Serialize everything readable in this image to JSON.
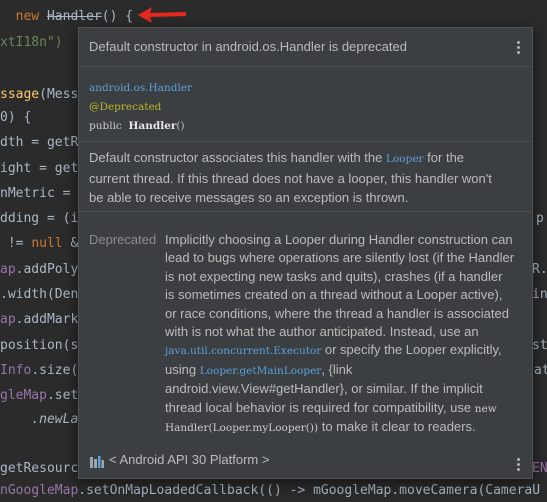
{
  "editor": {
    "line1": {
      "kw": "new",
      "cls": "Handler",
      "rest": "() {"
    },
    "line2": {
      "text": "xtI18n\")"
    },
    "line3": {
      "fn": "ssage",
      "rest": "(Mess"
    },
    "line4": {
      "text": "0) {"
    },
    "line5": {
      "text": "dth = getR"
    },
    "line6": {
      "text": "ight = get"
    },
    "line7": {
      "text": "nMetric ="
    },
    "line8": {
      "text": "dding = (i"
    },
    "line9": {
      "text": "!= ",
      "kw": "null",
      "rest": " &"
    },
    "line10": {
      "fld": "ap",
      "rest": ".addPoly"
    },
    "line11": {
      "text": ".width(Den"
    },
    "line12": {
      "fld": "ap",
      "rest": ".addMark"
    },
    "line13": {
      "text": "position(s"
    },
    "line14": {
      "fld": "Info",
      "rest": ".size("
    },
    "line15": {
      "fld": "gleMap",
      "rest": ".set"
    },
    "line16": {
      "text": ".newLa"
    },
    "line17": {
      "text": "getResourc"
    },
    "line18": {
      "fld": "nGoogleMap",
      "rest": ".setOnMapLoadedCallback(() -> mGoogleMap.moveCamera(CameraU"
    },
    "right_frags": [
      "p",
      "R.",
      "in",
      "st",
      "at",
      "ENG"
    ]
  },
  "popup": {
    "title": "Default constructor in android.os.Handler is deprecated",
    "signature": {
      "package": "android.os.Handler",
      "annotation": "@Deprecated",
      "modifier": "public",
      "method": "Handler",
      "parens": "()"
    },
    "description": {
      "part1": "Default constructor associates this handler with the ",
      "code1": "Looper",
      "part2": " for the current thread. If this thread does not have a looper, this handler won't be able to receive messages so an exception is thrown."
    },
    "deprecated": {
      "label": "Deprecated",
      "part1": "Implicitly choosing a Looper during Handler construction can lead to bugs where operations are silently lost (if the Handler is not expecting new tasks and quits), crashes (if a handler is sometimes created on a thread without a Looper active), or race conditions, where the thread a handler is associated with is not what the author anticipated. Instead, use an ",
      "code1": "java.util.concurrent.Executor",
      "part2": " or specify the Looper explicitly, using ",
      "code2": "Looper.getMainLooper",
      "part3": ", {link android.view.View#getHandler}, or similar. If the implicit thread local behavior is required for compatibility, use ",
      "code3": "new Handler(Looper.myLooper())",
      "part4": " to make it clear to readers."
    },
    "footer": {
      "label": "< Android API 30 Platform >"
    }
  },
  "colors": {
    "editor_bg": "#2b2b2b",
    "popup_bg": "#3c3f41",
    "link_blue": "#5c9fdb",
    "annotation": "#bbb529",
    "arrow_red": "#e8291f"
  },
  "icons": [
    "red-arrow-annotation",
    "more-options-icon",
    "library-icon"
  ]
}
